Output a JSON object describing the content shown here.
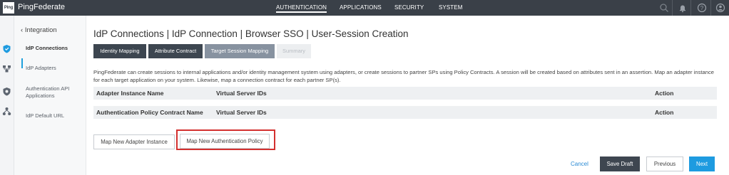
{
  "app": {
    "logo_text": "Ping",
    "brand": "PingFederate"
  },
  "topnav": {
    "items": [
      "AUTHENTICATION",
      "APPLICATIONS",
      "SECURITY",
      "SYSTEM"
    ],
    "active": "AUTHENTICATION",
    "icons": [
      "search-icon",
      "bell-icon",
      "help-icon",
      "user-icon"
    ]
  },
  "rail": {
    "icons": [
      "shield-icon",
      "network-icon",
      "badge-icon",
      "hierarchy-icon"
    ]
  },
  "sidenav": {
    "back_label": "Integration",
    "items": [
      "IdP Connections",
      "IdP Adapters",
      "Authentication API Applications",
      "IdP Default URL"
    ],
    "active": "IdP Connections"
  },
  "main": {
    "title": "IdP Connections | IdP Connection | Browser SSO | User-Session Creation",
    "tabs": [
      "Identity Mapping",
      "Attribute Contract",
      "Target Session Mapping",
      "Summary"
    ],
    "current_tab": "Target Session Mapping",
    "description": "PingFederate can create sessions to internal applications and/or identity management system using adapters, or create sessions to partner SPs using Policy Contracts. A session will be created based on attributes sent in an assertion. Map an adapter instance for each target application on your system. Likewise, map a connection contract for each partner SP(s).",
    "table1": {
      "headers": [
        "Adapter Instance Name",
        "Virtual Server IDs",
        "Action"
      ]
    },
    "table2": {
      "headers": [
        "Authentication Policy Contract Name",
        "Virtual Server IDs",
        "Action"
      ]
    },
    "map_adapter_label": "Map New Adapter Instance",
    "map_policy_label": "Map New Authentication Policy"
  },
  "footer": {
    "cancel_label": "Cancel",
    "save_draft_label": "Save Draft",
    "previous_label": "Previous",
    "next_label": "Next"
  },
  "colors": {
    "topbar": "#3a4048",
    "accent": "#1e9be0",
    "highlight": "#d3302f",
    "tab_dark": "#3d4650",
    "tab_current": "#8792a0"
  }
}
